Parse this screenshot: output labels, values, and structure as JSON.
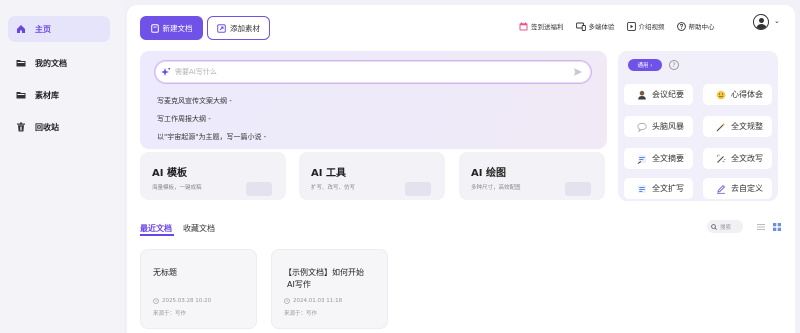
{
  "sidebar": {
    "items": [
      {
        "label": "主页",
        "icon": "home-icon",
        "active": true
      },
      {
        "label": "我的文档",
        "icon": "folder-icon",
        "active": false
      },
      {
        "label": "素材库",
        "icon": "folder-icon",
        "active": false
      },
      {
        "label": "回收站",
        "icon": "trash-icon",
        "active": false
      }
    ]
  },
  "toolbar": {
    "new_doc_label": "新建文档",
    "add_material_label": "添加素材",
    "links": [
      {
        "label": "签到送福利",
        "icon": "calendar-icon"
      },
      {
        "label": "多端体验",
        "icon": "devices-icon"
      },
      {
        "label": "介绍视频",
        "icon": "video-icon"
      },
      {
        "label": "帮助中心",
        "icon": "help-icon"
      }
    ]
  },
  "prompt": {
    "placeholder": "需要AI写什么",
    "suggestions": [
      "写麦克风宣传文案大纲 -",
      "写工作周报大纲 -",
      "以\"宇宙起源\"为主题，写一篇小说 -"
    ]
  },
  "tools": {
    "badge": "通用 ›",
    "items": [
      {
        "label": "会议纪要",
        "icon": "person-icon"
      },
      {
        "label": "心得体会",
        "icon": "smile-icon"
      },
      {
        "label": "头脑风暴",
        "icon": "chat-icon"
      },
      {
        "label": "全文规整",
        "icon": "magic-wand-icon"
      },
      {
        "label": "全文摘要",
        "icon": "summary-icon"
      },
      {
        "label": "全文改写",
        "icon": "rewrite-icon"
      },
      {
        "label": "全文扩写",
        "icon": "expand-icon"
      },
      {
        "label": "去自定义",
        "icon": "pen-icon"
      }
    ]
  },
  "cards": [
    {
      "title": "AI 模板",
      "subtitle": "海量模板，一键成稿"
    },
    {
      "title": "AI 工具",
      "subtitle": "扩写、改写、仿写"
    },
    {
      "title": "AI 绘图",
      "subtitle": "多种尺寸，高效配图"
    }
  ],
  "tabs": {
    "recent": "最近文档",
    "favorites": "收藏文档",
    "search_placeholder": "搜索"
  },
  "docs": [
    {
      "title": "无标题",
      "date": "2025.03.28 10:20",
      "source": "来源于：写作"
    },
    {
      "title_line1": "【示例文档】如何开始",
      "title_line2": "AI写作",
      "date": "2024.01.03 11:18",
      "source": "来源于：写作"
    }
  ],
  "colors": {
    "accent": "#7152e8",
    "sidebar_active_bg": "#e6e4fb"
  }
}
